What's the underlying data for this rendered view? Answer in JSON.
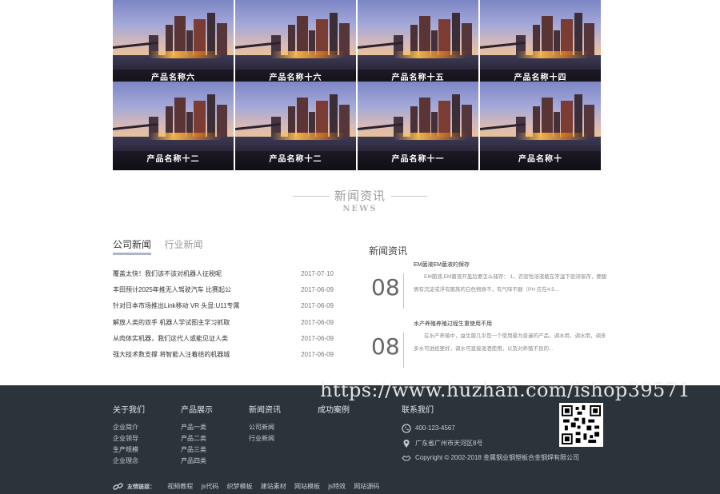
{
  "products": [
    {
      "name": "产品名称六"
    },
    {
      "name": "产品名称十六"
    },
    {
      "name": "产品名称十五"
    },
    {
      "name": "产品名称十四"
    },
    {
      "name": "产品名称十二"
    },
    {
      "name": "产品名称十二"
    },
    {
      "name": "产品名称十一"
    },
    {
      "name": "产品名称十"
    }
  ],
  "news_section": {
    "title_cn": "新闻资讯",
    "title_en": "NEWS"
  },
  "tabs": [
    {
      "label": "公司新闻"
    },
    {
      "label": "行业新闻"
    }
  ],
  "news_list": [
    {
      "title": "覆盖太快！我们该不该对机器人征税呢",
      "date": "2017-07-10"
    },
    {
      "title": "丰田预计2025年推无人驾驶汽车 比赛起公",
      "date": "2017-06-09"
    },
    {
      "title": "针对日本市场推出Link移动 VR 头显:U11专属",
      "date": "2017-06-09"
    },
    {
      "title": "解放人类的双手 机器人学试图主学习抓取",
      "date": "2017-06-09"
    },
    {
      "title": "从肉体实机器，我们这代人或能见证人类",
      "date": "2017-06-09"
    },
    {
      "title": "强大技术数支撑 将智能入注着结的机器城",
      "date": "2017-06-09"
    }
  ],
  "right_news": {
    "title": "新闻资讯",
    "items": [
      {
        "day": "08",
        "title": "EM菌液EM菌液的保存",
        "desc": "EM菌液,EM菌液开盖后要怎么储存： 1、农密性溶液瓶在常温下密闭保存，要酸情有沉淀或浮有菌族的白色物质不，有气味不酸（PH 应在4.5..."
      },
      {
        "day": "08",
        "title": "水产养殖养殖过程生重使用不用",
        "desc": "在水产养殖中，益生菌几乎是一个使用最为普遍的产品，调水用，调水用，调多多水可进经更好，调水可直接泼洒使用，以及对养殖不良的..."
      }
    ]
  },
  "footer": {
    "columns": [
      {
        "title": "关于我们",
        "links": [
          "企业简介",
          "企业领导",
          "生产规模",
          "企业理念"
        ]
      },
      {
        "title": "产品展示",
        "links": [
          "产品一类",
          "产品二类",
          "产品三类",
          "产品四类"
        ]
      },
      {
        "title": "新闻资讯",
        "links": [
          "公司新闻",
          "行业新闻"
        ]
      },
      {
        "title": "成功案例",
        "links": []
      }
    ],
    "contact": {
      "title": "联系我们",
      "phone": "400-123-4567",
      "address": "广东省广州市天河区8号",
      "copyright": "Copyright © 2002-2018 金属钢业钢塑板合金钢焊有限公司"
    },
    "friend_links_label": "友情链接：",
    "friend_links": [
      "视频教程",
      "js代码",
      "织梦模板",
      "建站素材",
      "网站模板",
      "js特效",
      "网站源码"
    ]
  },
  "watermark": "https://www.huzhan.com/ishop39571",
  "colors": {
    "footer_bg": "#2c343b",
    "tab_underline": "#adb7c7"
  }
}
